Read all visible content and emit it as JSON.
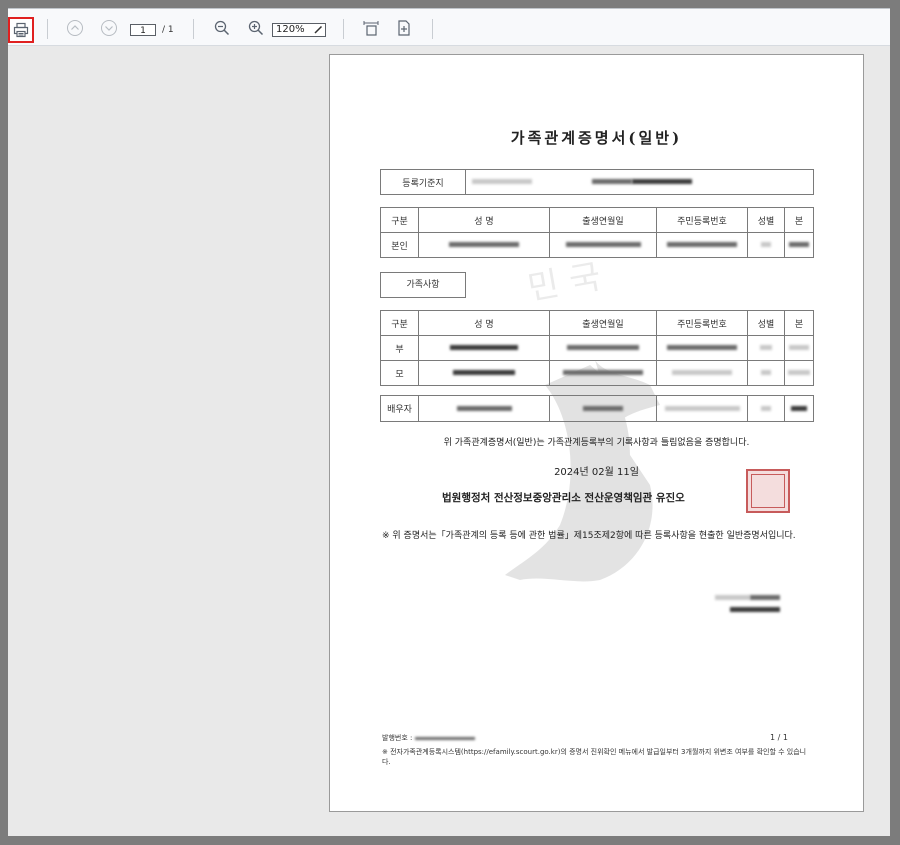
{
  "toolbar": {
    "page_current": "1",
    "page_separator": "/",
    "page_total": "1",
    "zoom": "120%"
  },
  "document": {
    "title": "가족관계증명서(일반)",
    "reg_label": "등록기준지",
    "headers": [
      "구분",
      "성 명",
      "출생연월일",
      "주민등록번호",
      "성별",
      "본"
    ],
    "self_label": "본인",
    "family_label": "가족사항",
    "rows": [
      "부",
      "모"
    ],
    "spouse_label": "배우자",
    "certify": "위 가족관계증명서(일반)는 가족관계등록부의 기록사항과 틀림없음을 증명합니다.",
    "date": "2024년 02월 11일",
    "issuer": "법원행정처 전산정보중앙관리소 전산운영책임관 유진오",
    "note": "※ 위 증명서는「가족관계의 등록 등에 관한 법률」제15조제2항에 따른 등록사항을 현출한 일반증명서입니다.",
    "issue_no_label": "발행번호 :",
    "page_info": "1 / 1",
    "footer_note": "※ 전자가족관계등록시스템(https://efamily.scourt.go.kr)의 증명서 진위확인 메뉴에서 발급일부터 3개월까지 위변조 여부를 확인할 수 있습니다.",
    "watermark": "대한민국"
  }
}
